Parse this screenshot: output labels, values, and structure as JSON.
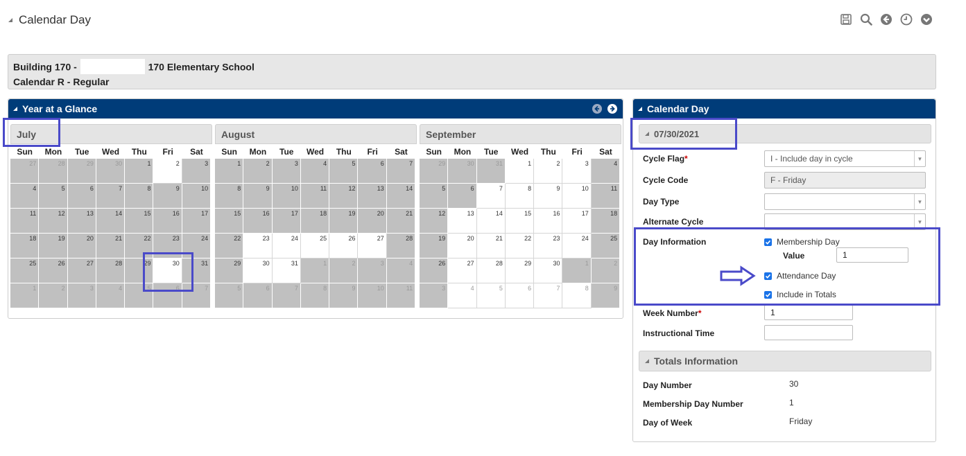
{
  "page": {
    "title": "Calendar Day"
  },
  "info": {
    "building_prefix": "Building 170 -",
    "building_suffix": "170 Elementary School",
    "calendar": "Calendar R - Regular"
  },
  "year_at_a_glance": {
    "title": "Year at a Glance",
    "weekdays": [
      "Sun",
      "Mon",
      "Tue",
      "Wed",
      "Thu",
      "Fri",
      "Sat"
    ],
    "months": [
      {
        "name": "July",
        "days": [
          [
            27,
            0,
            0
          ],
          [
            28,
            0,
            0
          ],
          [
            29,
            0,
            0
          ],
          [
            30,
            0,
            0
          ],
          [
            1,
            1,
            0
          ],
          [
            2,
            1,
            1
          ],
          [
            3,
            1,
            0
          ],
          [
            4,
            1,
            0
          ],
          [
            5,
            1,
            0
          ],
          [
            6,
            1,
            0
          ],
          [
            7,
            1,
            0
          ],
          [
            8,
            1,
            0
          ],
          [
            9,
            1,
            0
          ],
          [
            10,
            1,
            0
          ],
          [
            11,
            1,
            0
          ],
          [
            12,
            1,
            0
          ],
          [
            13,
            1,
            0
          ],
          [
            14,
            1,
            0
          ],
          [
            15,
            1,
            0
          ],
          [
            16,
            1,
            0
          ],
          [
            17,
            1,
            0
          ],
          [
            18,
            1,
            0
          ],
          [
            19,
            1,
            0
          ],
          [
            20,
            1,
            0
          ],
          [
            21,
            1,
            0
          ],
          [
            22,
            1,
            0
          ],
          [
            23,
            1,
            0
          ],
          [
            24,
            1,
            0
          ],
          [
            25,
            1,
            0
          ],
          [
            26,
            1,
            0
          ],
          [
            27,
            1,
            0
          ],
          [
            28,
            1,
            0
          ],
          [
            29,
            1,
            0
          ],
          [
            30,
            1,
            1
          ],
          [
            31,
            1,
            0
          ],
          [
            1,
            0,
            0
          ],
          [
            2,
            0,
            0
          ],
          [
            3,
            0,
            0
          ],
          [
            4,
            0,
            0
          ],
          [
            5,
            0,
            0
          ],
          [
            6,
            0,
            0
          ],
          [
            7,
            0,
            0
          ]
        ]
      },
      {
        "name": "August",
        "days": [
          [
            1,
            1,
            0
          ],
          [
            2,
            1,
            0
          ],
          [
            3,
            1,
            0
          ],
          [
            4,
            1,
            0
          ],
          [
            5,
            1,
            0
          ],
          [
            6,
            1,
            0
          ],
          [
            7,
            1,
            0
          ],
          [
            8,
            1,
            0
          ],
          [
            9,
            1,
            0
          ],
          [
            10,
            1,
            0
          ],
          [
            11,
            1,
            0
          ],
          [
            12,
            1,
            0
          ],
          [
            13,
            1,
            0
          ],
          [
            14,
            1,
            0
          ],
          [
            15,
            1,
            0
          ],
          [
            16,
            1,
            0
          ],
          [
            17,
            1,
            0
          ],
          [
            18,
            1,
            0
          ],
          [
            19,
            1,
            0
          ],
          [
            20,
            1,
            0
          ],
          [
            21,
            1,
            0
          ],
          [
            22,
            1,
            0
          ],
          [
            23,
            1,
            1
          ],
          [
            24,
            1,
            1
          ],
          [
            25,
            1,
            1
          ],
          [
            26,
            1,
            1
          ],
          [
            27,
            1,
            1
          ],
          [
            28,
            1,
            0
          ],
          [
            29,
            1,
            0
          ],
          [
            30,
            1,
            1
          ],
          [
            31,
            1,
            1
          ],
          [
            1,
            0,
            0
          ],
          [
            2,
            0,
            0
          ],
          [
            3,
            0,
            0
          ],
          [
            4,
            0,
            0
          ],
          [
            5,
            0,
            0
          ],
          [
            6,
            0,
            0
          ],
          [
            7,
            0,
            0
          ],
          [
            8,
            0,
            0
          ],
          [
            9,
            0,
            0
          ],
          [
            10,
            0,
            0
          ],
          [
            11,
            0,
            0
          ]
        ]
      },
      {
        "name": "September",
        "days": [
          [
            29,
            0,
            0
          ],
          [
            30,
            0,
            0
          ],
          [
            31,
            0,
            0
          ],
          [
            1,
            1,
            1
          ],
          [
            2,
            1,
            1
          ],
          [
            3,
            1,
            1
          ],
          [
            4,
            1,
            0
          ],
          [
            5,
            1,
            0
          ],
          [
            6,
            1,
            0
          ],
          [
            7,
            1,
            1
          ],
          [
            8,
            1,
            1
          ],
          [
            9,
            1,
            1
          ],
          [
            10,
            1,
            1
          ],
          [
            11,
            1,
            0
          ],
          [
            12,
            1,
            0
          ],
          [
            13,
            1,
            1
          ],
          [
            14,
            1,
            1
          ],
          [
            15,
            1,
            1
          ],
          [
            16,
            1,
            1
          ],
          [
            17,
            1,
            1
          ],
          [
            18,
            1,
            0
          ],
          [
            19,
            1,
            0
          ],
          [
            20,
            1,
            1
          ],
          [
            21,
            1,
            1
          ],
          [
            22,
            1,
            1
          ],
          [
            23,
            1,
            1
          ],
          [
            24,
            1,
            1
          ],
          [
            25,
            1,
            0
          ],
          [
            26,
            1,
            0
          ],
          [
            27,
            1,
            1
          ],
          [
            28,
            1,
            1
          ],
          [
            29,
            1,
            1
          ],
          [
            30,
            1,
            1
          ],
          [
            1,
            0,
            0
          ],
          [
            2,
            0,
            0
          ],
          [
            3,
            0,
            0
          ],
          [
            4,
            0,
            1
          ],
          [
            5,
            0,
            1
          ],
          [
            6,
            0,
            1
          ],
          [
            7,
            0,
            1
          ],
          [
            8,
            0,
            1
          ],
          [
            9,
            0,
            0
          ]
        ]
      }
    ]
  },
  "calendar_day": {
    "title": "Calendar Day",
    "date": "07/30/2021",
    "cycle_flag": {
      "label": "Cycle Flag",
      "value": "I - Include day in cycle"
    },
    "cycle_code": {
      "label": "Cycle Code",
      "value": "F - Friday"
    },
    "day_type": {
      "label": "Day Type",
      "value": ""
    },
    "alternate_cycle": {
      "label": "Alternate Cycle",
      "value": ""
    },
    "day_information": {
      "label": "Day Information",
      "membership_day": "Membership Day",
      "value_label": "Value",
      "value": "1",
      "attendance_day": "Attendance Day",
      "include_in_totals": "Include in Totals"
    },
    "week_number": {
      "label": "Week Number",
      "value": "1"
    },
    "instructional_time": {
      "label": "Instructional Time",
      "value": ""
    },
    "totals": {
      "title": "Totals Information",
      "day_number": {
        "label": "Day Number",
        "value": "30"
      },
      "membership_day_number": {
        "label": "Membership Day Number",
        "value": "1"
      },
      "day_of_week": {
        "label": "Day of Week",
        "value": "Friday"
      }
    }
  },
  "colors": {
    "header_blue": "#003c79",
    "highlight": "#4a4ac9",
    "non_school_day": "#c0c0c0",
    "checkbox": "#1a73e8"
  }
}
